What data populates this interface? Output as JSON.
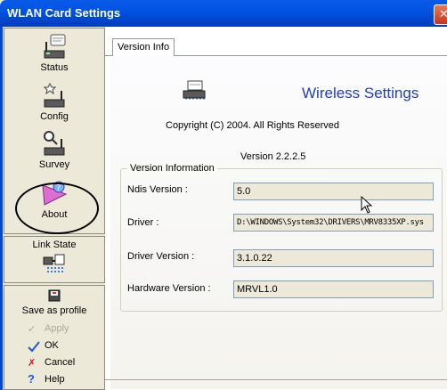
{
  "window": {
    "title": "WLAN Card Settings",
    "close_glyph": "✕"
  },
  "sidebar": {
    "nav": [
      {
        "label": "Status",
        "icon": "status-icon"
      },
      {
        "label": "Config",
        "icon": "config-icon"
      },
      {
        "label": "Survey",
        "icon": "survey-icon"
      },
      {
        "label": "About",
        "icon": "about-icon"
      }
    ],
    "link_state": {
      "label": "Link State",
      "icon": "link-state-icon"
    },
    "actions": {
      "save_profile": "Save as profile",
      "apply": "Apply",
      "ok": "OK",
      "cancel": "Cancel",
      "help": "Help"
    }
  },
  "tabs": [
    {
      "label": "Version Info",
      "active": true
    }
  ],
  "version_info": {
    "heading": "Wireless Settings",
    "copyright": "Copyright (C) 2004. All Rights Reserved",
    "version": "Version 2.2.2.5",
    "group_label": "Version Information",
    "fields": [
      {
        "label": "Ndis Version :",
        "value": "5.0"
      },
      {
        "label": "Driver :",
        "value": "D:\\WINDOWS\\System32\\DRIVERS\\MRV8335XP.sys"
      },
      {
        "label": "Driver Version :",
        "value": "3.1.0.22"
      },
      {
        "label": "Hardware Version :",
        "value": "MRVL1.0"
      }
    ]
  },
  "colors": {
    "titlebar": "#0054e3",
    "accent": "#1f3fbf",
    "window_bg": "#ece9d8"
  }
}
